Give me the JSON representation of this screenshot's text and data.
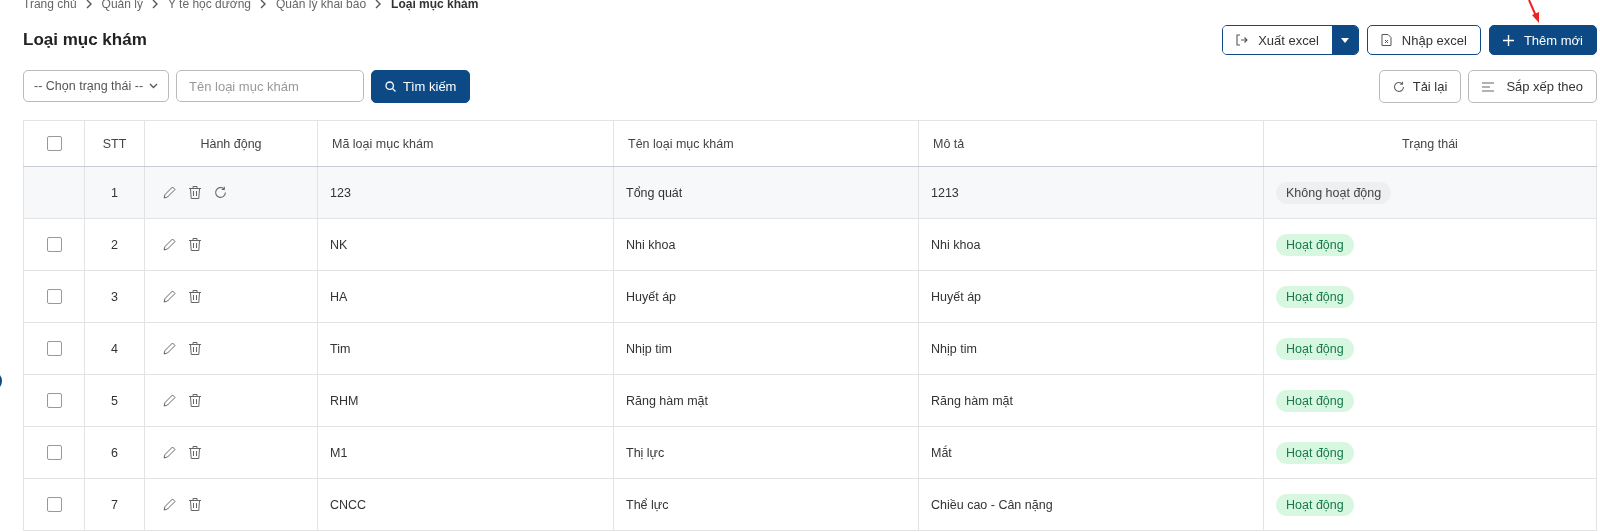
{
  "breadcrumb": [
    "Trang chủ",
    "Quản lý",
    "Y tế học đường",
    "Quản lý khai báo",
    "Loại mục khám"
  ],
  "title": "Loại mục khám",
  "actions": {
    "export": "Xuất excel",
    "import": "Nhập excel",
    "add": "Thêm mới"
  },
  "filters": {
    "status_select": "-- Chọn trạng thái --",
    "name_placeholder": "Tên loại mục khám",
    "search": "Tìm kiếm"
  },
  "tools": {
    "reload": "Tải lại",
    "sort": "Sắp xếp theo"
  },
  "table": {
    "columns": [
      "STT",
      "Hành động",
      "Mã loại mục khám",
      "Tên loại mục khám",
      "Mô tả",
      "Trạng thái"
    ],
    "header_checked": false,
    "rows": [
      {
        "stt": "1",
        "code": "123",
        "name": "Tổng quát",
        "description": "1213",
        "status": "Không hoạt động",
        "active": false,
        "restorable": true
      },
      {
        "stt": "2",
        "code": "NK",
        "name": "Nhi khoa",
        "description": "Nhi khoa",
        "status": "Hoạt động",
        "active": true,
        "checked": false,
        "restorable": false
      },
      {
        "stt": "3",
        "code": "HA",
        "name": "Huyết áp",
        "description": "Huyết áp",
        "status": "Hoạt động",
        "active": true,
        "checked": false,
        "restorable": false
      },
      {
        "stt": "4",
        "code": "Tim",
        "name": "Nhịp tim",
        "description": "Nhịp tim",
        "status": "Hoạt động",
        "active": true,
        "checked": false,
        "restorable": false
      },
      {
        "stt": "5",
        "code": "RHM",
        "name": "Răng hàm mặt",
        "description": "Răng hàm mặt",
        "status": "Hoạt động",
        "active": true,
        "checked": false,
        "restorable": false
      },
      {
        "stt": "6",
        "code": "M1",
        "name": "Thị lực",
        "description": "Mắt",
        "status": "Hoạt động",
        "active": true,
        "checked": false,
        "restorable": false
      },
      {
        "stt": "7",
        "code": "CNCC",
        "name": "Thể lực",
        "description": "Chiều cao - Cân nặng",
        "status": "Hoạt động",
        "active": true,
        "checked": false,
        "restorable": false
      }
    ]
  }
}
